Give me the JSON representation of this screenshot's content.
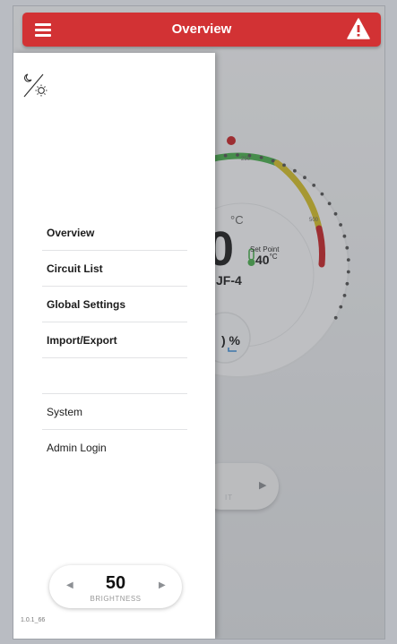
{
  "app_bar": {
    "title": "Overview",
    "menu_icon": "hamburger-menu-icon",
    "alert_icon": "warning-triangle-icon",
    "accent_color": "#d23234"
  },
  "dashboard": {
    "gauge": {
      "tick_labels": [
        "250",
        "500"
      ],
      "temperature_partial": "0",
      "unit": "°C",
      "set_point_label": "Set Point",
      "set_point_value": "40",
      "set_point_unit": "°C",
      "circuit_name_partial": "JF-4",
      "percent_partial": ") %",
      "color_green": "#4caf50",
      "color_yellow": "#d4bf2a",
      "color_red": "#c8282a"
    },
    "partial_button_label": "IT"
  },
  "drawer": {
    "theme_toggle_icon": "moon-sun-toggle-icon",
    "menu_items": [
      {
        "label": "Overview"
      },
      {
        "label": "Circuit List"
      },
      {
        "label": "Global Settings"
      },
      {
        "label": "Import/Export"
      },
      {
        "label": ""
      },
      {
        "label": "System"
      },
      {
        "label": "Admin Login"
      }
    ],
    "brightness": {
      "value": "50",
      "label": "BRIGHTNESS"
    },
    "version": "1.0.1_66"
  }
}
